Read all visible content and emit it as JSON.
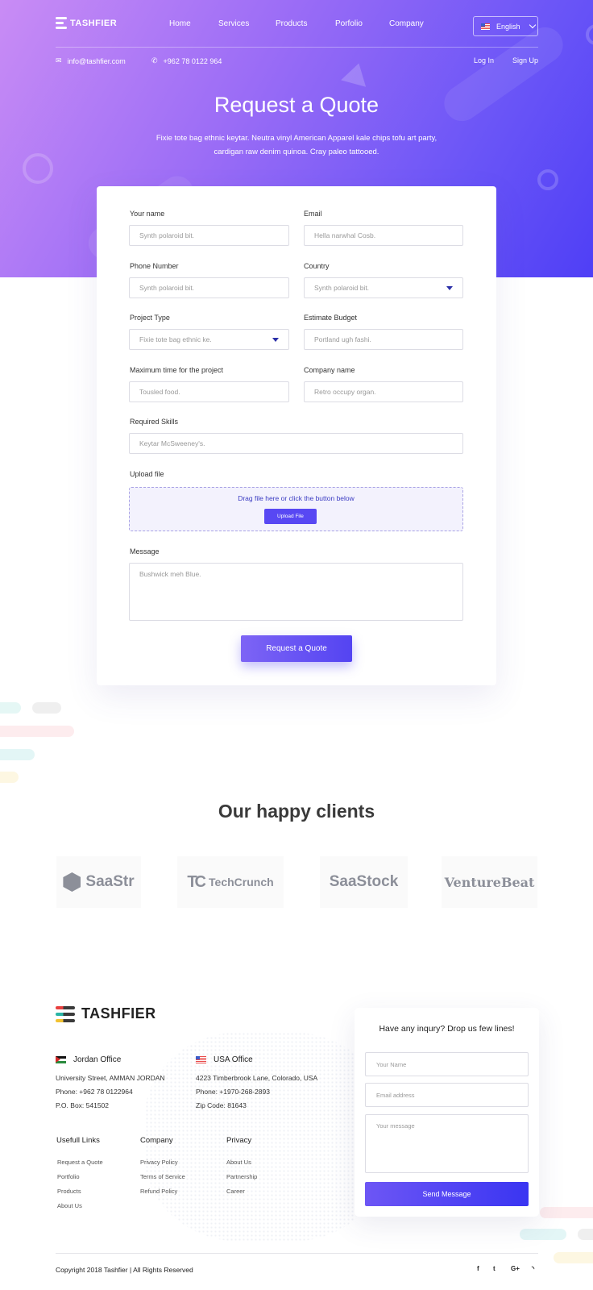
{
  "header": {
    "logo_text": "TASHFIER",
    "nav": [
      "Home",
      "Services",
      "Products",
      "Porfolio",
      "Company"
    ],
    "language": "English",
    "email": "info@tashfier.com",
    "phone": "+962 78 0122 964",
    "login": "Log In",
    "signup": "Sign Up"
  },
  "hero": {
    "title": "Request a Quote",
    "subtitle_line1": "Fixie tote bag ethnic keytar. Neutra vinyl American Apparel kale chips tofu art party,",
    "subtitle_line2": "cardigan raw denim quinoa. Cray paleo tattooed."
  },
  "form": {
    "name_label": "Your name",
    "name_placeholder": "Synth polaroid bit.",
    "email_label": "Email",
    "email_placeholder": "Hella narwhal Cosb.",
    "phone_label": "Phone Number",
    "phone_placeholder": "Synth polaroid bit.",
    "country_label": "Country",
    "country_value": "Synth polaroid bit.",
    "project_type_label": "Project Type",
    "project_type_value": "Fixie tote bag ethnic ke.",
    "budget_label": "Estimate Budget",
    "budget_placeholder": "Portland ugh fashi.",
    "max_time_label": "Maximum time for the project",
    "max_time_placeholder": "Tousled food.",
    "company_label": "Company name",
    "company_placeholder": "Retro occupy organ.",
    "skills_label": "Required Skills",
    "skills_placeholder": "Keytar McSweeney's.",
    "upload_label": "Upload file",
    "upload_hint": "Drag file here or click the button below",
    "upload_button": "Upload File",
    "message_label": "Message",
    "message_placeholder": "Bushwick meh Blue.",
    "submit": "Request a Quote"
  },
  "clients": {
    "title": "Our happy clients",
    "logos": [
      "SaaStr",
      "TechCrunch",
      "SaaStock",
      "VentureBeat"
    ]
  },
  "footer": {
    "logo_text": "TASHFIER",
    "jordan": {
      "title": "Jordan Office",
      "address": "University Street, AMMAN JORDAN",
      "phone": "Phone: +962 78 0122964",
      "box": "P.O. Box: 541502"
    },
    "usa": {
      "title": "USA Office",
      "address": "4223 Timberbrook Lane, Colorado, USA",
      "phone": "Phone: +1970-268-2893",
      "zip": "Zip Code: 81643"
    },
    "columns": [
      {
        "title": "Usefull Links",
        "links": [
          "Request a Quote",
          "Portfolio",
          "Products",
          "About Us"
        ]
      },
      {
        "title": "Company",
        "links": [
          "Privacy Policy",
          "Terms of Service",
          "Refund Policy"
        ]
      },
      {
        "title": "Privacy",
        "links": [
          "About Us",
          "Partnership",
          "Career"
        ]
      }
    ],
    "contact_form": {
      "title": "Have any inqury? Drop us few lines!",
      "name_placeholder": "Your Name",
      "email_placeholder": "Email address",
      "message_placeholder": "Your message",
      "button": "Send Message"
    },
    "copyright": "Copyright 2018 Tashfier | All Rights Reserved",
    "social": [
      "f",
      "t",
      "G+",
      "rss"
    ]
  },
  "colors": {
    "accent": "#5848f3",
    "hero_start": "#c98cf5",
    "hero_end": "#4f3ff6"
  }
}
